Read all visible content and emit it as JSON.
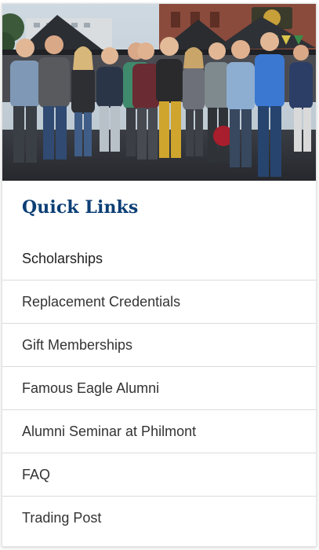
{
  "quick_links": {
    "title": "Quick Links",
    "items": [
      {
        "label": "Scholarships"
      },
      {
        "label": "Replacement Credentials"
      },
      {
        "label": "Gift Memberships"
      },
      {
        "label": "Famous Eagle Alumni"
      },
      {
        "label": "Alumni Seminar at Philmont"
      },
      {
        "label": "FAQ"
      },
      {
        "label": "Trading Post"
      }
    ]
  },
  "colors": {
    "title": "#0c3f75",
    "link_text": "#333333",
    "divider": "#dcdcdc"
  }
}
